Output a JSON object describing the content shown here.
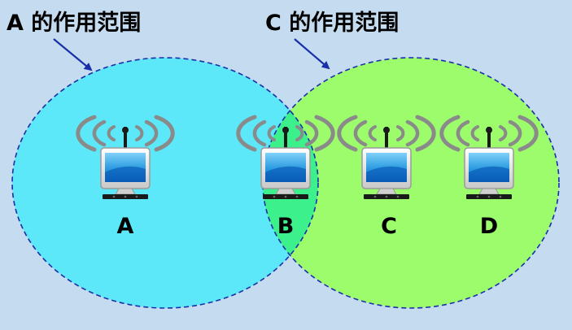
{
  "labels": {
    "range_a": "A 的作用范围",
    "range_c": "C 的作用范围"
  },
  "nodes": [
    {
      "id": "A",
      "label": "A"
    },
    {
      "id": "B",
      "label": "B"
    },
    {
      "id": "C",
      "label": "C"
    },
    {
      "id": "D",
      "label": "D"
    }
  ],
  "colors": {
    "background": "#c5dcf0",
    "range_a_fill": "#5ce8f8",
    "range_c_fill": "#9cfc6c",
    "overlap_fill": "#3cf08c",
    "range_border": "#1a2fa8",
    "arrow": "#1a2fa8"
  },
  "icons": {
    "node": "wireless-computer-icon"
  }
}
